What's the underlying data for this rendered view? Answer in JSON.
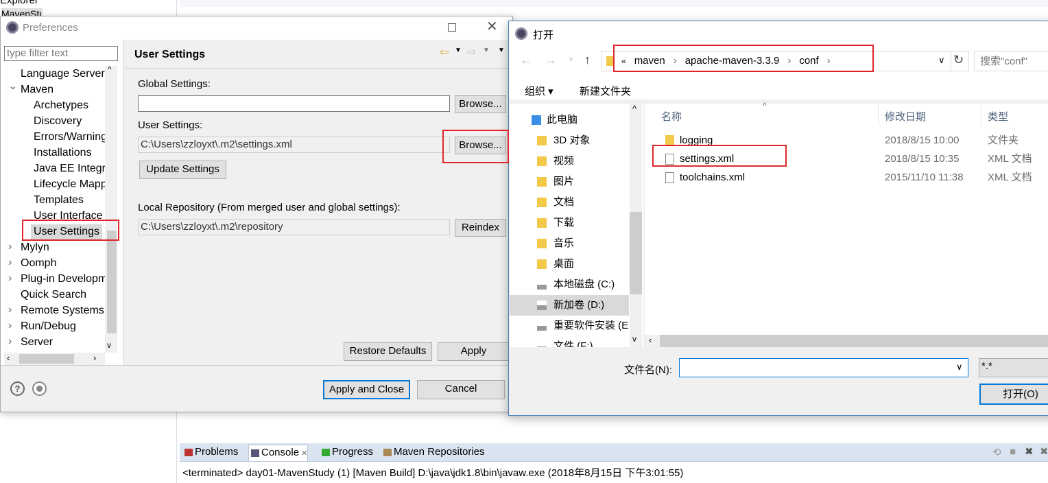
{
  "background": {
    "explorer_tab": "Explorer",
    "project_item": "MavenStudy"
  },
  "preferences": {
    "title": "Preferences",
    "filter_placeholder": "type filter text",
    "tree": [
      {
        "label": "Language Server",
        "indent": 1
      },
      {
        "label": "Maven",
        "indent": 0,
        "expanded": true
      },
      {
        "label": "Archetypes",
        "indent": 2
      },
      {
        "label": "Discovery",
        "indent": 2
      },
      {
        "label": "Errors/Warnings",
        "indent": 2
      },
      {
        "label": "Installations",
        "indent": 2
      },
      {
        "label": "Java EE Integration",
        "indent": 2
      },
      {
        "label": "Lifecycle Mappings",
        "indent": 2
      },
      {
        "label": "Templates",
        "indent": 2
      },
      {
        "label": "User Interface",
        "indent": 2
      },
      {
        "label": "User Settings",
        "indent": 2,
        "selected": true
      },
      {
        "label": "Mylyn",
        "indent": 0
      },
      {
        "label": "Oomph",
        "indent": 0
      },
      {
        "label": "Plug-in Development",
        "indent": 0
      },
      {
        "label": "Quick Search",
        "indent": 1
      },
      {
        "label": "Remote Systems",
        "indent": 0
      },
      {
        "label": "Run/Debug",
        "indent": 0
      },
      {
        "label": "Server",
        "indent": 0
      }
    ],
    "page_title": "User Settings",
    "global_settings_label": "Global Settings:",
    "global_settings_value": "",
    "user_settings_label": "User Settings:",
    "user_settings_value": "C:\\Users\\zzloyxt\\.m2\\settings.xml",
    "browse_label": "Browse...",
    "update_settings": "Update Settings",
    "local_repo_label": "Local Repository (From merged user and global settings):",
    "local_repo_value": "C:\\Users\\zzloyxt\\.m2\\repository",
    "reindex": "Reindex",
    "restore_defaults": "Restore Defaults",
    "apply": "Apply",
    "apply_close": "Apply and Close",
    "cancel": "Cancel"
  },
  "open_dialog": {
    "title": "打开",
    "breadcrumb": [
      "«",
      "maven",
      "apache-maven-3.3.9",
      "conf"
    ],
    "search_placeholder": "搜索\"conf\"",
    "organize": "组织 ▾",
    "new_folder": "新建文件夹",
    "nav": [
      {
        "label": "此电脑",
        "icon": "pc-icon"
      },
      {
        "label": "3D 对象",
        "icon": "folder-3d-icon"
      },
      {
        "label": "视频",
        "icon": "video-folder-icon"
      },
      {
        "label": "图片",
        "icon": "pictures-folder-icon"
      },
      {
        "label": "文档",
        "icon": "documents-folder-icon"
      },
      {
        "label": "下载",
        "icon": "downloads-folder-icon"
      },
      {
        "label": "音乐",
        "icon": "music-folder-icon"
      },
      {
        "label": "桌面",
        "icon": "desktop-folder-icon"
      },
      {
        "label": "本地磁盘 (C:)",
        "icon": "drive-icon"
      },
      {
        "label": "新加卷 (D:)",
        "icon": "drive-icon",
        "selected": true
      },
      {
        "label": "重要软件安装 (E:)",
        "icon": "drive-icon"
      },
      {
        "label": "文件 (F:)",
        "icon": "drive-icon"
      }
    ],
    "columns": [
      "名称",
      "修改日期",
      "类型"
    ],
    "files": [
      {
        "name": "logging",
        "date": "2018/8/15 10:00",
        "type": "文件夹",
        "icon": "folder-icon"
      },
      {
        "name": "settings.xml",
        "date": "2018/8/15 10:35",
        "type": "XML 文档",
        "icon": "file-icon"
      },
      {
        "name": "toolchains.xml",
        "date": "2015/11/10 11:38",
        "type": "XML 文档",
        "icon": "file-icon"
      }
    ],
    "filename_label": "文件名(N):",
    "filename_value": "",
    "filter_value": "*.*",
    "open_button": "打开(O)"
  },
  "console": {
    "tabs": [
      "Problems",
      "Console",
      "Progress",
      "Maven Repositories"
    ],
    "active_tab": "Console",
    "output": "<terminated> day01-MavenStudy (1) [Maven Build] D:\\java\\jdk1.8\\bin\\javaw.exe (2018年8月15日 下午3:01:55)"
  },
  "colors": {
    "highlight_red": "#e0262b",
    "selection": "#d9d9d9",
    "button_focus": "#0078d7",
    "console_tabbar": "#dae4f0"
  }
}
